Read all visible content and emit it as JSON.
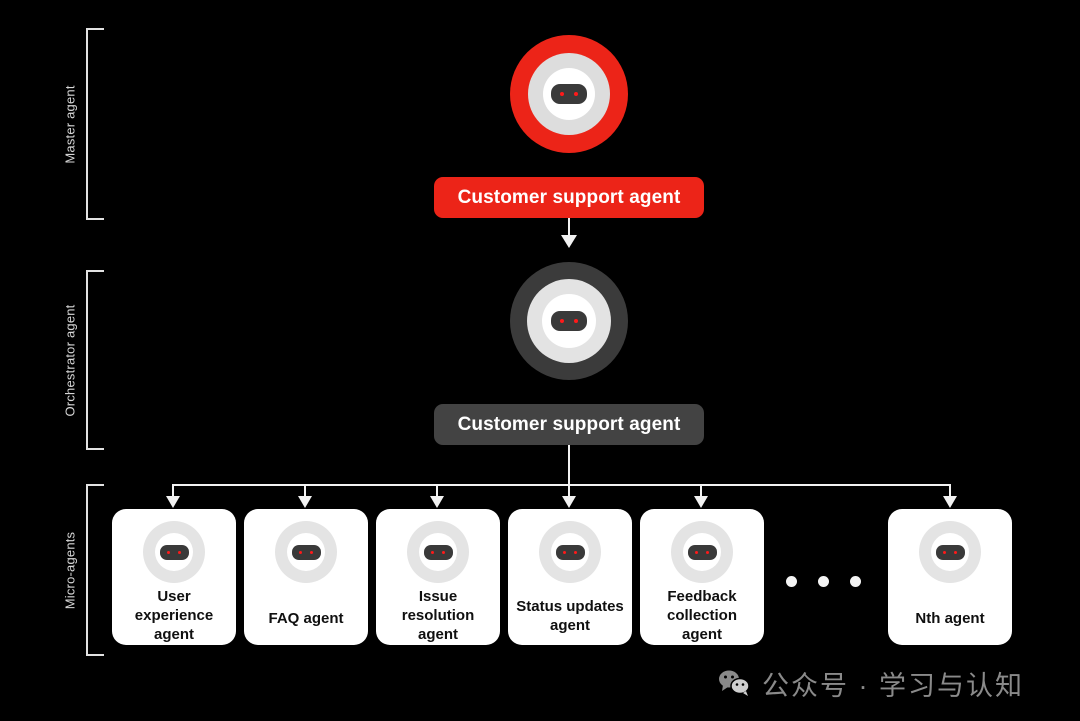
{
  "background_color": "#000000",
  "tiers": [
    {
      "id": "master",
      "label": "Master agent"
    },
    {
      "id": "orchestrator",
      "label": "Orchestrator agent"
    },
    {
      "id": "micro",
      "label": "Micro-agents"
    }
  ],
  "master": {
    "avatar_icon": "robot-avatar-icon",
    "ring_color": "#ec2418",
    "mid_ring_color": "#dddddd",
    "button_label": "Customer support agent",
    "button_color": "#ec2418",
    "button_text_color": "#ffffff"
  },
  "orchestrator": {
    "avatar_icon": "robot-avatar-icon",
    "ring_color": "#3b3b3b",
    "mid_ring_color": "#e3e3e3",
    "button_label": "Customer support agent",
    "button_color": "#434343",
    "button_text_color": "#ffffff"
  },
  "micro_agents": {
    "ellipsis": "• • •",
    "cards": [
      {
        "label": "User experience agent",
        "icon": "robot-avatar-icon"
      },
      {
        "label": "FAQ agent",
        "icon": "robot-avatar-icon"
      },
      {
        "label": "Issue resolution agent",
        "icon": "robot-avatar-icon"
      },
      {
        "label": "Status updates agent",
        "icon": "robot-avatar-icon"
      },
      {
        "label": "Feedback collection agent",
        "icon": "robot-avatar-icon"
      },
      {
        "label": "Nth agent",
        "icon": "robot-avatar-icon"
      }
    ]
  },
  "watermark": {
    "icon": "wechat-icon",
    "text": "公众号 · 学习与认知",
    "color": "#8a8a8a"
  },
  "colors": {
    "accent_red": "#ec2418",
    "eye_red": "#ff1a1a",
    "face_dark": "#3a3a3a",
    "connector": "#f2f2f2",
    "card_bg": "#ffffff",
    "label_gray": "#d7d7d7"
  }
}
